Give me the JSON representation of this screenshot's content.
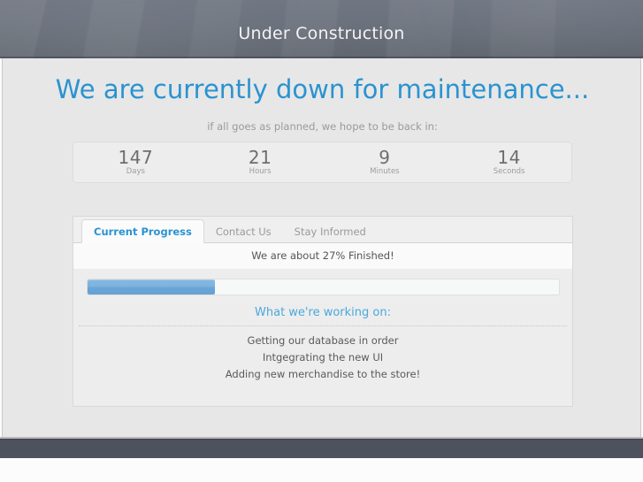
{
  "header": {
    "title": "Under Construction"
  },
  "main": {
    "headline": "We are currently down for maintenance...",
    "subline": "if all goes as planned, we hope to be back in:"
  },
  "countdown": {
    "units": [
      {
        "value": "147",
        "label": "Days"
      },
      {
        "value": "21",
        "label": "Hours"
      },
      {
        "value": "9",
        "label": "Minutes"
      },
      {
        "value": "14",
        "label": "Seconds"
      }
    ]
  },
  "tabs": [
    {
      "label": "Current Progress",
      "active": true
    },
    {
      "label": "Contact Us",
      "active": false
    },
    {
      "label": "Stay Informed",
      "active": false
    }
  ],
  "progress": {
    "status_text": "We are about 27% Finished!",
    "percent": 27,
    "percent_css": "27%"
  },
  "working_on": {
    "title": "What we're working on:",
    "items": [
      "Getting our database in order",
      "Intgegrating the new UI",
      "Adding new merchandise to the store!"
    ]
  },
  "colors": {
    "accent_blue": "#2a93d0",
    "link_blue": "#4aa8dc",
    "header_slate": "#656b77",
    "footer_slate": "#4d525e",
    "panel_gray": "#e7e7e7",
    "progress_fill": "#6aa5d6"
  }
}
